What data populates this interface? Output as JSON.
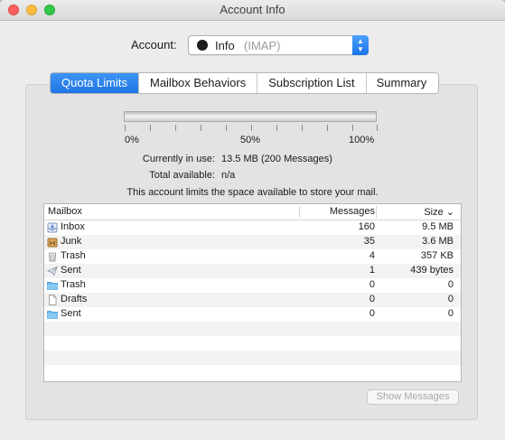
{
  "window": {
    "title": "Account Info"
  },
  "account": {
    "label": "Account:",
    "name": "Info",
    "type": "(IMAP)"
  },
  "tabs": [
    {
      "label": "Quota Limits",
      "active": true
    },
    {
      "label": "Mailbox Behaviors",
      "active": false
    },
    {
      "label": "Subscription List",
      "active": false
    },
    {
      "label": "Summary",
      "active": false
    }
  ],
  "quota": {
    "usage_fraction": 0.0,
    "ticks": [
      "0%",
      "50%",
      "100%"
    ],
    "in_use_label": "Currently in use:",
    "in_use_value": "13.5 MB (200 Messages)",
    "available_label": "Total available:",
    "available_value": "n/a",
    "note": "This account limits the space available to store your mail."
  },
  "table": {
    "columns": {
      "mailbox": "Mailbox",
      "messages": "Messages",
      "size": "Size ⌄"
    },
    "rows": [
      {
        "icon": "inbox-icon",
        "name": "Inbox",
        "messages": "160",
        "size": "9.5 MB"
      },
      {
        "icon": "junk-icon",
        "name": "Junk",
        "messages": "35",
        "size": "3.6 MB"
      },
      {
        "icon": "trash-icon",
        "name": "Trash",
        "messages": "4",
        "size": "357 KB"
      },
      {
        "icon": "sent-icon",
        "name": "Sent",
        "messages": "1",
        "size": "439 bytes"
      },
      {
        "icon": "folder-icon",
        "name": "Trash",
        "messages": "0",
        "size": "0"
      },
      {
        "icon": "document-icon",
        "name": "Drafts",
        "messages": "0",
        "size": "0"
      },
      {
        "icon": "folder-icon",
        "name": "Sent",
        "messages": "0",
        "size": "0"
      }
    ]
  },
  "buttons": {
    "show_messages": "Show Messages"
  }
}
